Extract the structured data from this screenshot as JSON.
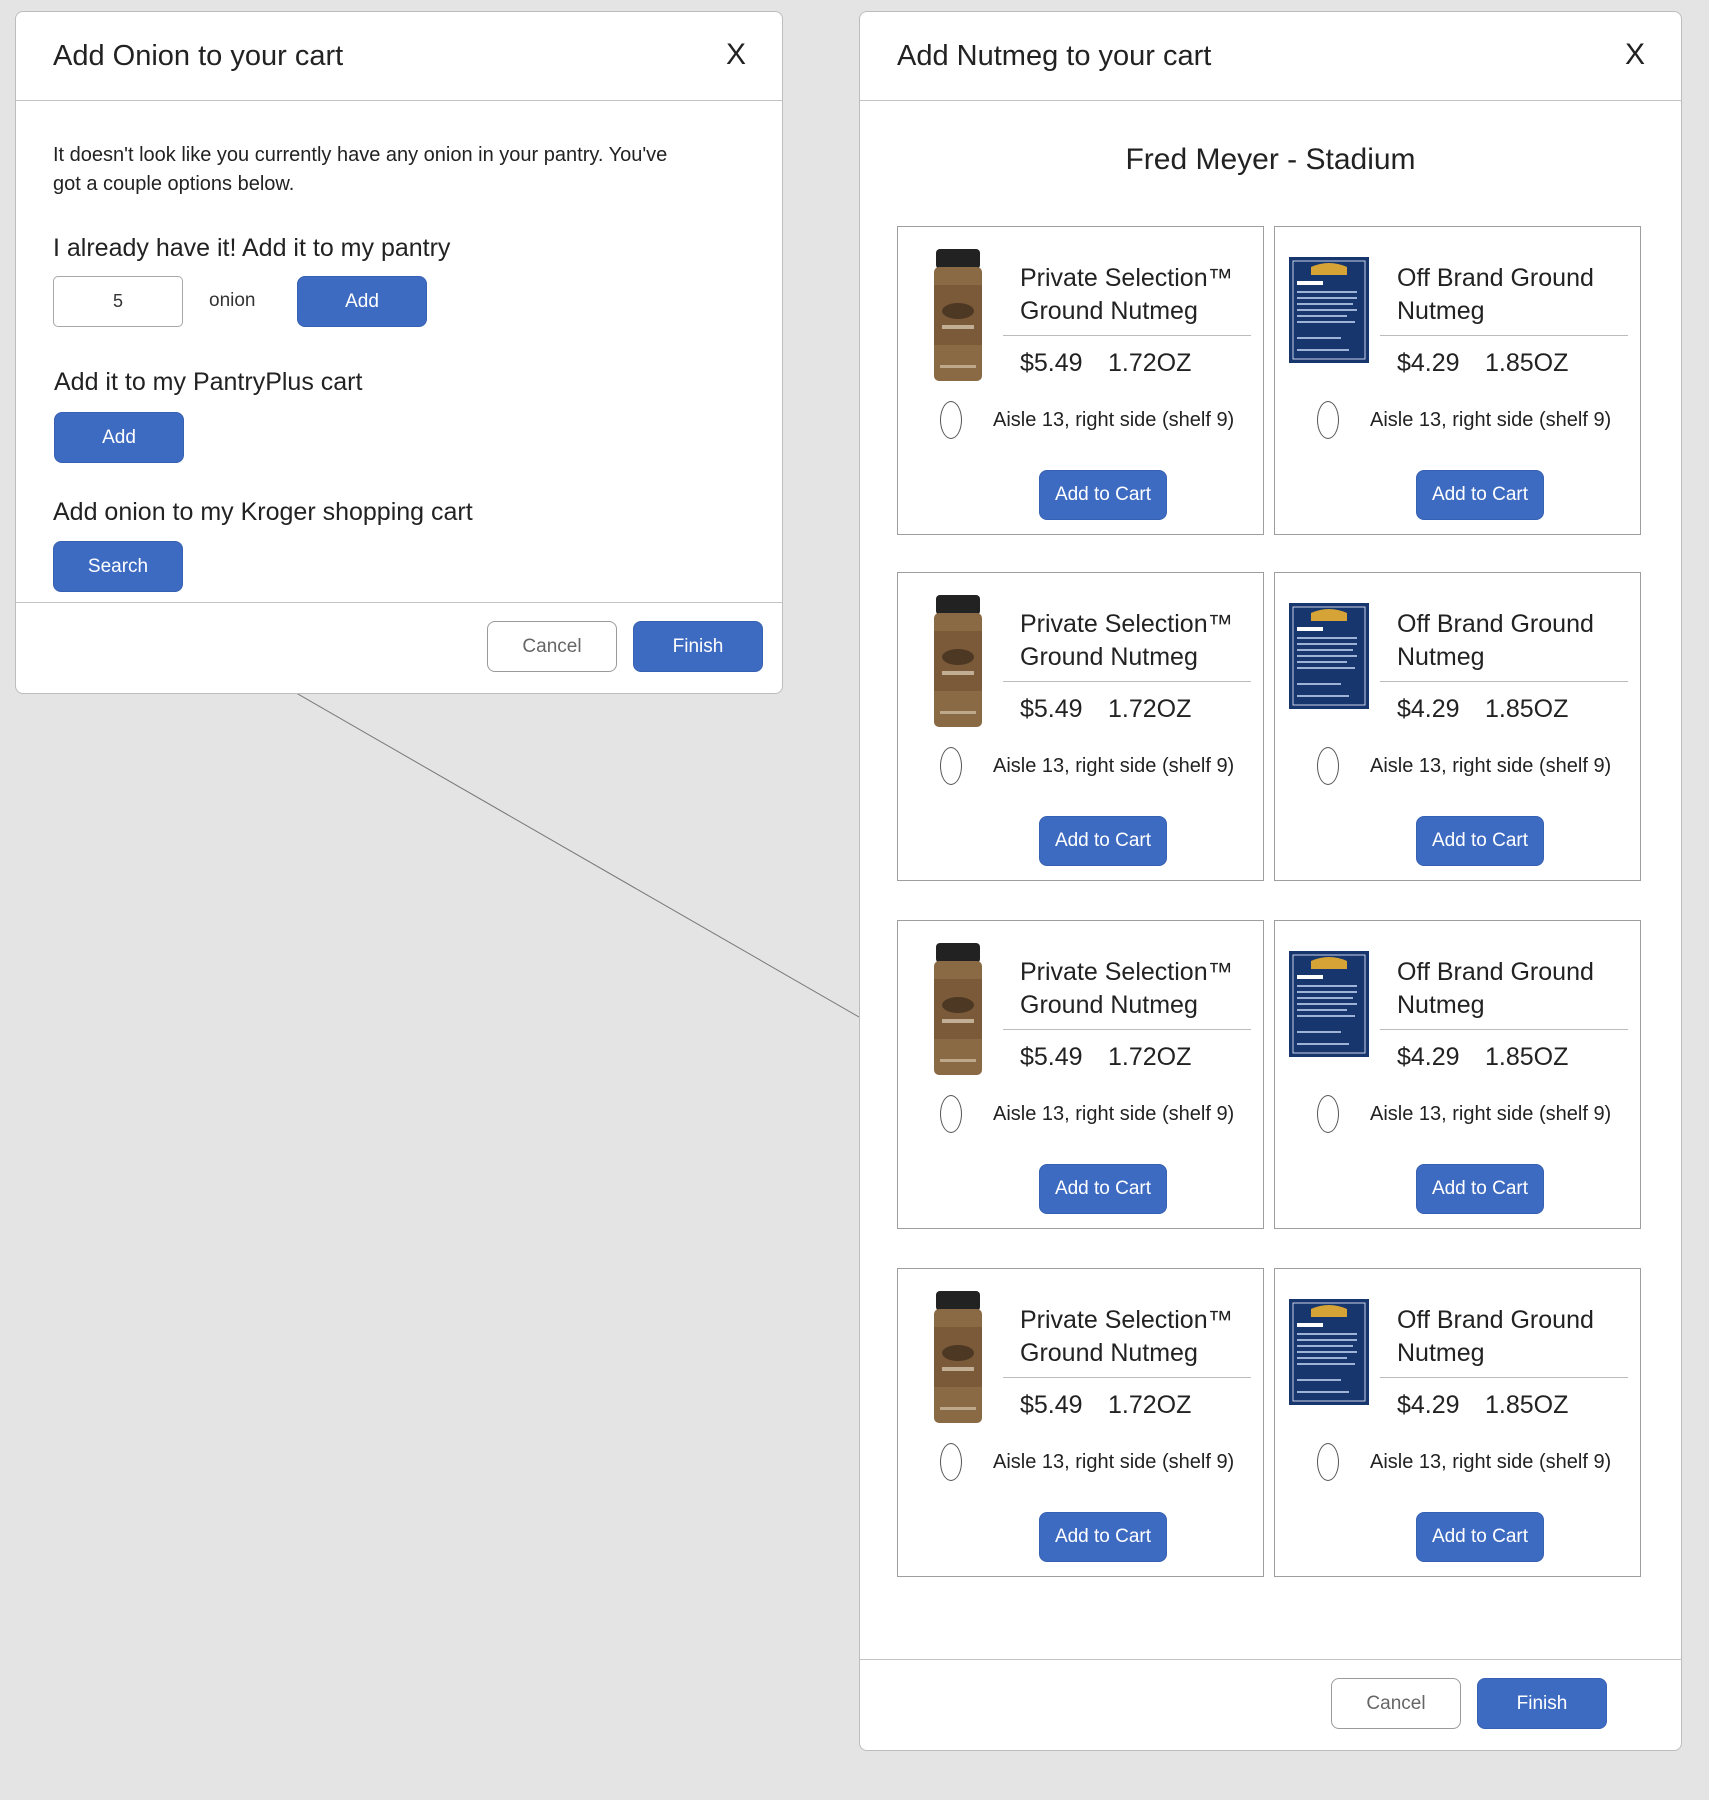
{
  "onion_dialog": {
    "title": "Add Onion to your cart",
    "close": "X",
    "intro": "It doesn't look like you currently have any onion in your pantry. You've got a couple options below.",
    "pantry_heading": "I already have it! Add it to my pantry",
    "quantity_value": "5",
    "unit_label": "onion",
    "pantry_add_label": "Add",
    "pantryplus_heading": "Add it to my PantryPlus cart",
    "pantryplus_add_label": "Add",
    "kroger_heading": "Add onion to my Kroger shopping cart",
    "search_label": "Search",
    "cancel_label": "Cancel",
    "finish_label": "Finish"
  },
  "nutmeg_dialog": {
    "title": "Add Nutmeg to your cart",
    "close": "X",
    "store": "Fred Meyer - Stadium",
    "products": [
      {
        "name1": "Private Selection™",
        "name2": "Ground Nutmeg",
        "price": "$5.49",
        "size": "1.72OZ",
        "aisle": "Aisle 13, right side (shelf 9)",
        "button": "Add to Cart",
        "image": "spice-jar"
      },
      {
        "name1": "Off Brand Ground",
        "name2": "Nutmeg",
        "price": "$4.29",
        "size": "1.85OZ",
        "aisle": "Aisle 13, right side (shelf 9)",
        "button": "Add to Cart",
        "image": "spice-box"
      },
      {
        "name1": "Private Selection™",
        "name2": "Ground Nutmeg",
        "price": "$5.49",
        "size": "1.72OZ",
        "aisle": "Aisle 13, right side (shelf 9)",
        "button": "Add to Cart",
        "image": "spice-jar"
      },
      {
        "name1": "Off Brand Ground",
        "name2": "Nutmeg",
        "price": "$4.29",
        "size": "1.85OZ",
        "aisle": "Aisle 13, right side (shelf 9)",
        "button": "Add to Cart",
        "image": "spice-box"
      },
      {
        "name1": "Private Selection™",
        "name2": "Ground Nutmeg",
        "price": "$5.49",
        "size": "1.72OZ",
        "aisle": "Aisle 13, right side (shelf 9)",
        "button": "Add to Cart",
        "image": "spice-jar"
      },
      {
        "name1": "Off Brand Ground",
        "name2": "Nutmeg",
        "price": "$4.29",
        "size": "1.85OZ",
        "aisle": "Aisle 13, right side (shelf 9)",
        "button": "Add to Cart",
        "image": "spice-box"
      },
      {
        "name1": "Private Selection™",
        "name2": "Ground Nutmeg",
        "price": "$5.49",
        "size": "1.72OZ",
        "aisle": "Aisle 13, right side (shelf 9)",
        "button": "Add to Cart",
        "image": "spice-jar"
      },
      {
        "name1": "Off Brand Ground",
        "name2": "Nutmeg",
        "price": "$4.29",
        "size": "1.85OZ",
        "aisle": "Aisle 13, right side (shelf 9)",
        "button": "Add to Cart",
        "image": "spice-box"
      }
    ],
    "cancel_label": "Cancel",
    "finish_label": "Finish"
  },
  "colors": {
    "primary": "#3e6bc2",
    "background": "#e4e4e4",
    "jar_label": "#8a6a44",
    "box_label": "#17366e"
  }
}
